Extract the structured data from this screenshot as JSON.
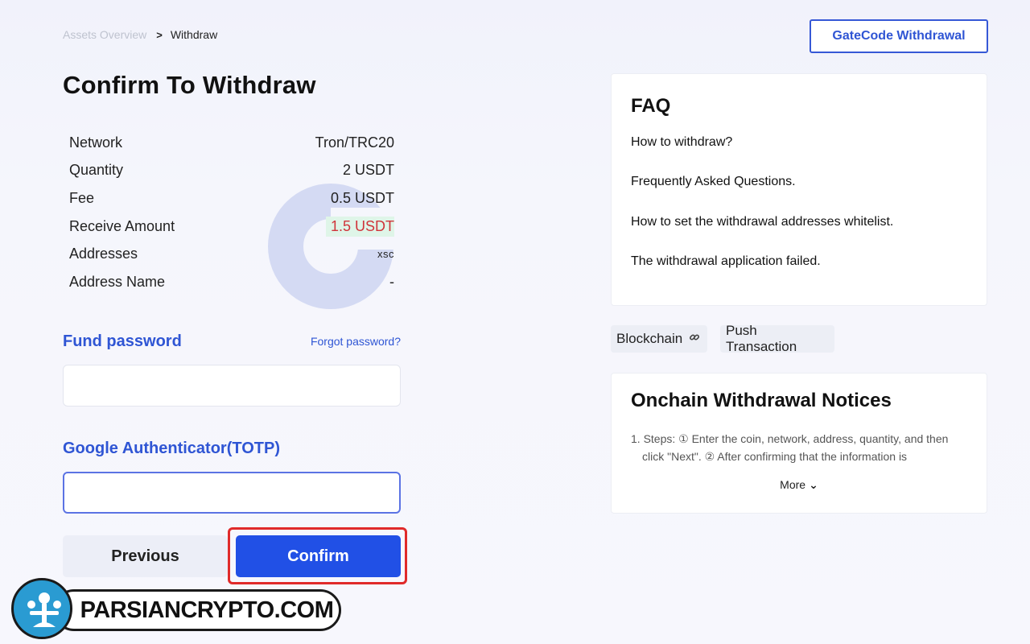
{
  "breadcrumb": {
    "root": "Assets Overview",
    "current": "Withdraw"
  },
  "page_title": "Confirm To Withdraw",
  "details": [
    {
      "label": "Network",
      "value": "Tron/TRC20"
    },
    {
      "label": "Quantity",
      "value": "2 USDT"
    },
    {
      "label": "Fee",
      "value": "0.5 USDT"
    },
    {
      "label": "Receive Amount",
      "value": "1.5 USDT"
    },
    {
      "label": "Addresses",
      "value": "xsc"
    },
    {
      "label": "Address Name",
      "value": "-"
    }
  ],
  "fund_password": {
    "label": "Fund password",
    "forgot": "Forgot password?",
    "value": "",
    "placeholder": ""
  },
  "totp": {
    "label": "Google Authenticator(TOTP)",
    "value": "",
    "placeholder": ""
  },
  "buttons": {
    "previous": "Previous",
    "confirm": "Confirm"
  },
  "gatecode_button": "GateCode Withdrawal",
  "faq": {
    "title": "FAQ",
    "items": [
      "How to withdraw?",
      "Frequently Asked Questions.",
      "How to set the withdrawal addresses whitelist.",
      "The withdrawal application failed."
    ]
  },
  "chips": {
    "blockchain": "Blockchain",
    "push": "Push Transaction"
  },
  "notices": {
    "title": "Onchain Withdrawal Notices",
    "line1": "1. Steps: ① Enter the coin, network, address, quantity, and then",
    "line2": "click \"Next\". ② After confirming that the information is",
    "more": "More"
  },
  "watermark": {
    "text": "PARSIANCRYPTO.COM"
  },
  "colors": {
    "accent": "#2150e6",
    "link": "#2f55d4",
    "highlight_border": "#e02a2a",
    "receive_amount": "#d0343a"
  },
  "icons": [
    "chevron-right-icon",
    "link-icon",
    "chevron-down-icon",
    "parsiancrypto-logo-icon"
  ]
}
